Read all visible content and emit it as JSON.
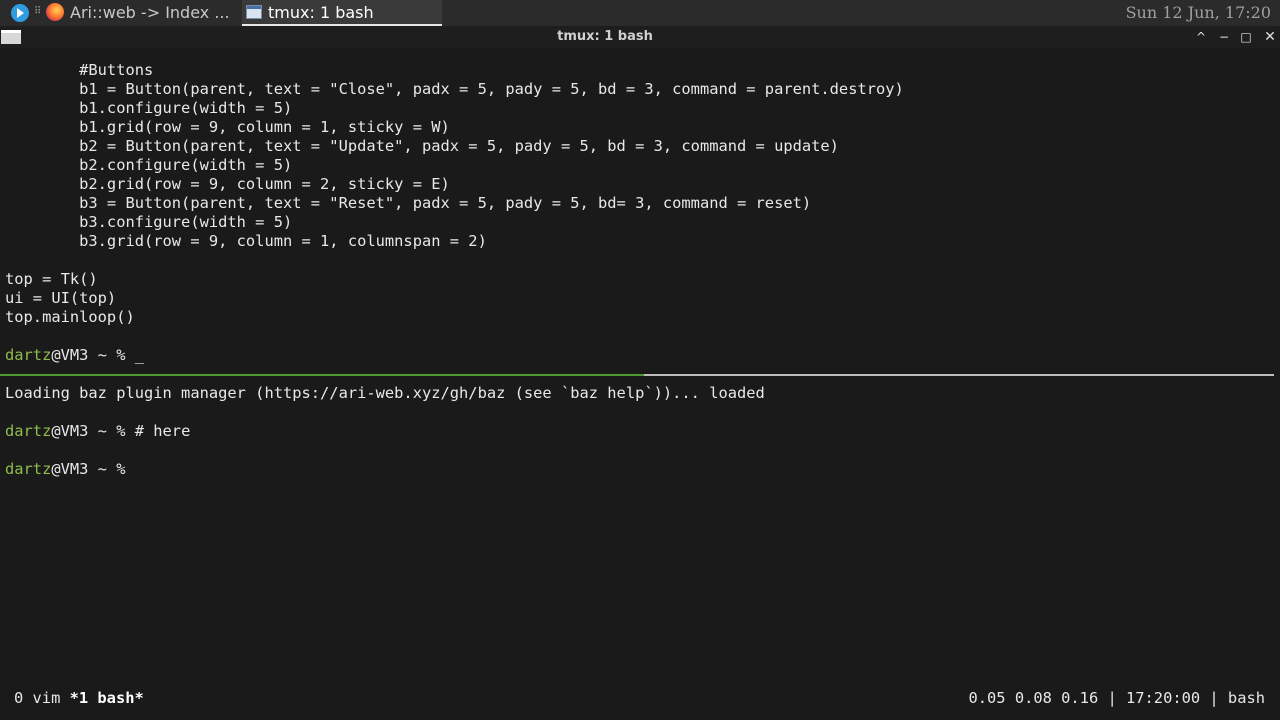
{
  "panel": {
    "launcher_icon": "launcher-icon",
    "grip": "⠿",
    "tasks": [
      {
        "label": "Ari::web -> Index ...",
        "icon": "firefox-icon"
      },
      {
        "label": "tmux: 1 bash",
        "icon": "terminal-icon"
      }
    ],
    "clock": "Sun 12 Jun, 17:20"
  },
  "window": {
    "title": "tmux: 1 bash",
    "buttons": {
      "shade": "^",
      "minimize": "−",
      "maximize": "□",
      "close": "✕"
    }
  },
  "top_pane": {
    "lines": [
      "        #Buttons",
      "        b1 = Button(parent, text = \"Close\", padx = 5, pady = 5, bd = 3, command = parent.destroy)",
      "        b1.configure(width = 5)",
      "        b1.grid(row = 9, column = 1, sticky = W)",
      "        b2 = Button(parent, text = \"Update\", padx = 5, pady = 5, bd = 3, command = update)",
      "        b2.configure(width = 5)",
      "        b2.grid(row = 9, column = 2, sticky = E)",
      "        b3 = Button(parent, text = \"Reset\", padx = 5, pady = 5, bd= 3, command = reset)",
      "        b3.configure(width = 5)",
      "        b3.grid(row = 9, column = 1, columnspan = 2)",
      "",
      "top = Tk()",
      "ui = UI(top)",
      "top.mainloop()",
      ""
    ],
    "prompt_user": "dartz",
    "prompt_rest": "@VM3 ~ % _"
  },
  "bottom_pane": {
    "loading_line": "Loading baz plugin manager (https://ari-web.xyz/gh/baz (see `baz help`))... loaded",
    "prompt1_user": "dartz",
    "prompt1_rest": "@VM3 ~ % # here",
    "prompt2_user": "dartz",
    "prompt2_rest": "@VM3 ~ %"
  },
  "status_bar": {
    "window0": "0 vim ",
    "window1": "*1 bash*",
    "right": "0.05 0.08 0.16 | 17:20:00 | bash"
  },
  "colors": {
    "prompt_user": "#8fbd4c",
    "active_pane_border": "#4f9a2f",
    "background": "#1a1a1a"
  }
}
